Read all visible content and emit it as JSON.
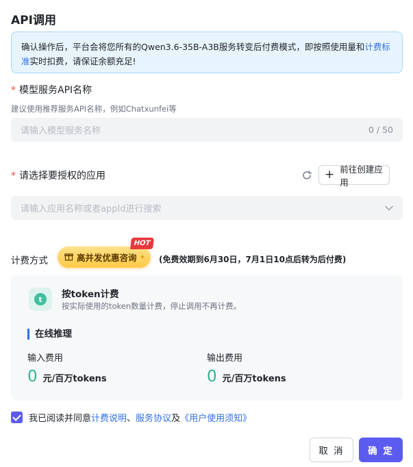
{
  "title": "API调用",
  "notice": {
    "before": "确认操作后，平台会将您所有的Qwen3.6-35B-A3B服务转变后付费模式，即按照使用量和",
    "link": "计费标准",
    "after": "实时扣费，请保证余额充足!"
  },
  "service_name": {
    "required_mark": "*",
    "label": "模型服务API名称",
    "hint": "建议使用推荐服务API名称，例如Chatxunfei等",
    "placeholder": "请输入模型服务名称",
    "counter": "0 / 50"
  },
  "app_select": {
    "required_mark": "*",
    "label": "请选择要授权的应用",
    "create_button": "前往创建应用",
    "placeholder": "请输入应用名称或者appId进行搜索"
  },
  "billing": {
    "label": "计费方式",
    "promo_button": "高并发优惠咨询",
    "hot_badge": "HOT",
    "free_note": "(免费效期到6月30日，7月1日10点后转为后付费)",
    "card": {
      "title": "按token计费",
      "desc": "按实际使用的token数量计费，停止调用不再计费。",
      "section_title": "在线推理",
      "input_label": "输入费用",
      "input_value": "0",
      "input_unit": "元/百万tokens",
      "output_label": "输出费用",
      "output_value": "0",
      "output_unit": "元/百万tokens"
    }
  },
  "agreement": {
    "checked": true,
    "prefix": "我已阅读并同意",
    "link1": "计费说明",
    "sep1": "、",
    "link2": "服务协议",
    "sep2": "及",
    "link3": "《用户使用须知》"
  },
  "footer": {
    "cancel": "取 消",
    "confirm": "确 定"
  },
  "colors": {
    "primary": "#5b5bf0",
    "link": "#2f6fe4",
    "price": "#34b393",
    "required": "#f04b3e"
  }
}
